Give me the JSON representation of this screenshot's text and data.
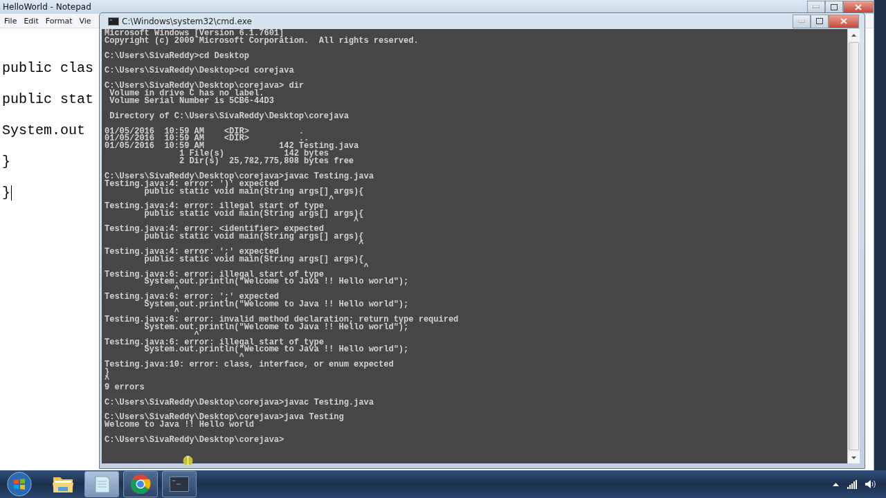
{
  "notepad": {
    "title": "HelloWorld - Notepad",
    "menu": [
      "File",
      "Edit",
      "Format",
      "Vie"
    ],
    "lines": [
      "public clas",
      "public stat",
      "System.out",
      "}",
      "}"
    ]
  },
  "cmd": {
    "title": "C:\\Windows\\system32\\cmd.exe",
    "blocks": [
      [
        "Microsoft Windows [Version 6.1.7601]",
        "Copyright (c) 2009 Microsoft Corporation.  All rights reserved."
      ],
      [
        "C:\\Users\\SivaReddy>cd Desktop"
      ],
      [
        "C:\\Users\\SivaReddy\\Desktop>cd corejava"
      ],
      [
        "C:\\Users\\SivaReddy\\Desktop\\corejava> dir",
        " Volume in drive C has no label.",
        " Volume Serial Number is 5CB6-44D3"
      ],
      [
        " Directory of C:\\Users\\SivaReddy\\Desktop\\corejava"
      ],
      [
        "01/05/2016  10:59 AM    <DIR>          .",
        "01/05/2016  10:59 AM    <DIR>          ..",
        "01/05/2016  10:59 AM               142 Testing.java",
        "               1 File(s)            142 bytes",
        "               2 Dir(s)  25,782,775,808 bytes free"
      ],
      [
        "C:\\Users\\SivaReddy\\Desktop\\corejava>javac Testing.java",
        "Testing.java:4: error: ')' expected",
        "        public static void main(String args[] args){",
        "                                             ^",
        "Testing.java:4: error: illegal start of type",
        "        public static void main(String args[] args){",
        "                                                  ^",
        "Testing.java:4: error: <identifier> expected",
        "        public static void main(String args[] args){",
        "                                                   ^",
        "Testing.java:4: error: ';' expected",
        "        public static void main(String args[] args){",
        "                                                    ^",
        "Testing.java:6: error: illegal start of type",
        "        System.out.println(\"Welcome to Java !! Hello world\");",
        "              ^",
        "Testing.java:6: error: ';' expected",
        "        System.out.println(\"Welcome to Java !! Hello world\");",
        "              ^",
        "Testing.java:6: error: invalid method declaration; return type required",
        "        System.out.println(\"Welcome to Java !! Hello world\");",
        "                  ^",
        "Testing.java:6: error: illegal start of type",
        "        System.out.println(\"Welcome to Java !! Hello world\");",
        "                           ^",
        "Testing.java:10: error: class, interface, or enum expected",
        "}",
        "^",
        "9 errors"
      ],
      [
        "C:\\Users\\SivaReddy\\Desktop\\corejava>javac Testing.java"
      ],
      [
        "C:\\Users\\SivaReddy\\Desktop\\corejava>java Testing",
        "Welcome to Java !! Hello world"
      ],
      [
        "C:\\Users\\SivaReddy\\Desktop\\corejava>"
      ]
    ]
  },
  "taskbar": {
    "apps": [
      {
        "kind": "folder",
        "running": false,
        "selected": false
      },
      {
        "kind": "notepad",
        "running": true,
        "selected": true
      },
      {
        "kind": "chrome",
        "running": true,
        "selected": false
      },
      {
        "kind": "cmd",
        "running": true,
        "selected": false
      }
    ]
  }
}
